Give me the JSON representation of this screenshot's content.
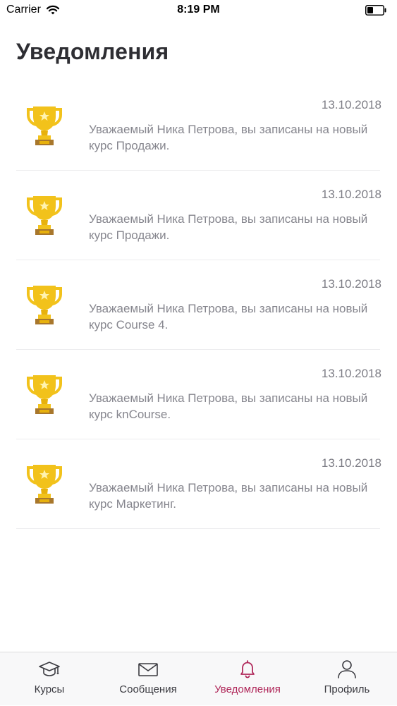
{
  "status_bar": {
    "carrier": "Carrier",
    "time": "8:19 PM"
  },
  "page": {
    "title": "Уведомления"
  },
  "colors": {
    "accent": "#b0285a",
    "trophy_gold": "#f2c21b",
    "trophy_base": "#a8772c"
  },
  "notifications": [
    {
      "icon": "trophy-icon",
      "date": "13.10.2018",
      "text": "Уважаемый Ника Петрова, вы записаны на новый курс Продажи."
    },
    {
      "icon": "trophy-icon",
      "date": "13.10.2018",
      "text": "Уважаемый Ника Петрова, вы записаны на новый курс Продажи."
    },
    {
      "icon": "trophy-icon",
      "date": "13.10.2018",
      "text": "Уважаемый Ника Петрова, вы записаны на новый курс Course 4."
    },
    {
      "icon": "trophy-icon",
      "date": "13.10.2018",
      "text": "Уважаемый Ника Петрова, вы записаны на новый курс knCourse."
    },
    {
      "icon": "trophy-icon",
      "date": "13.10.2018",
      "text": "Уважаемый Ника Петрова, вы записаны на новый курс Маркетинг."
    }
  ],
  "tab_bar": {
    "tabs": [
      {
        "label": "Курсы",
        "icon": "graduation-cap-icon",
        "active": false
      },
      {
        "label": "Сообщения",
        "icon": "envelope-icon",
        "active": false
      },
      {
        "label": "Уведомления",
        "icon": "bell-icon",
        "active": true
      },
      {
        "label": "Профиль",
        "icon": "user-icon",
        "active": false
      }
    ]
  }
}
